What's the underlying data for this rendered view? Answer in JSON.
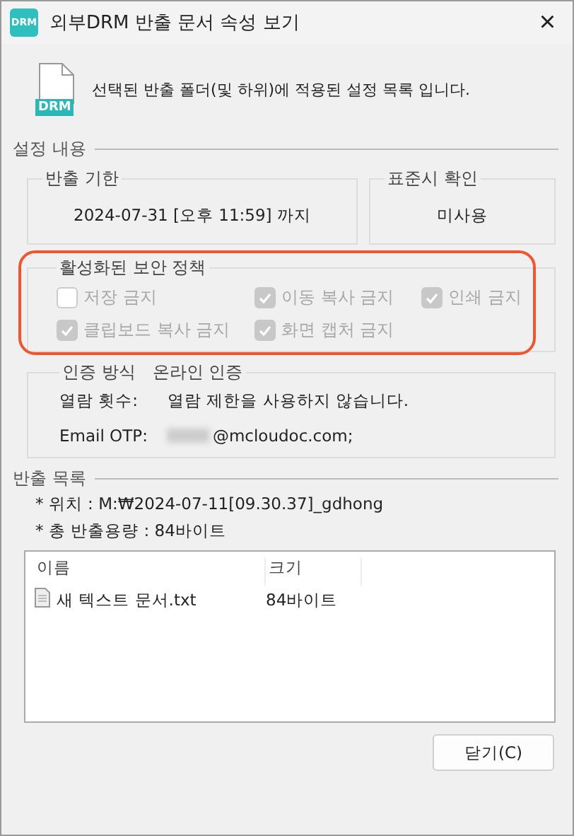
{
  "window": {
    "logo_text": "DRM",
    "title": "외부DRM 반출 문서 속성 보기",
    "close": "×"
  },
  "header": {
    "icon_text": "DRM",
    "description": "선택된 반출 폴더(및 하위)에 적용된 설정 목록 입니다."
  },
  "settings": {
    "title": "설정 내용",
    "deadline": {
      "label": "반출 기한",
      "value": "2024-07-31 [오후 11:59] 까지"
    },
    "timezone": {
      "label": "표준시 확인",
      "value": "미사용"
    },
    "policy": {
      "label": "활성화된 보안 정책",
      "highlighted": true,
      "items": [
        {
          "label": "저장 금지",
          "checked": false,
          "disabled": true
        },
        {
          "label": "이동 복사 금지",
          "checked": true,
          "disabled": true
        },
        {
          "label": "인쇄 금지",
          "checked": true,
          "disabled": true
        },
        {
          "label": "클립보드 복사 금지",
          "checked": true,
          "disabled": true
        },
        {
          "label": "화면 캡처 금지",
          "checked": true,
          "disabled": true
        }
      ]
    },
    "auth": {
      "label": "인증 방식",
      "method": "온라인 인증",
      "rows": [
        {
          "label": "열람 횟수:",
          "value": "열람 제한을 사용하지 않습니다."
        },
        {
          "label": "Email OTP:",
          "value": "@mcloudoc.com;",
          "redacted": true
        }
      ]
    }
  },
  "export": {
    "title": "반출 목록",
    "lines": [
      "* 위치 : M:₩2024-07-11[09.30.37]_gdhong",
      "* 총 반출용량 : 84바이트"
    ],
    "table": {
      "columns": [
        "이름",
        "크기"
      ],
      "rows": [
        {
          "name": "새 텍스트 문서.txt",
          "size": "84바이트"
        }
      ]
    }
  },
  "buttons": [
    "닫기(C)"
  ]
}
